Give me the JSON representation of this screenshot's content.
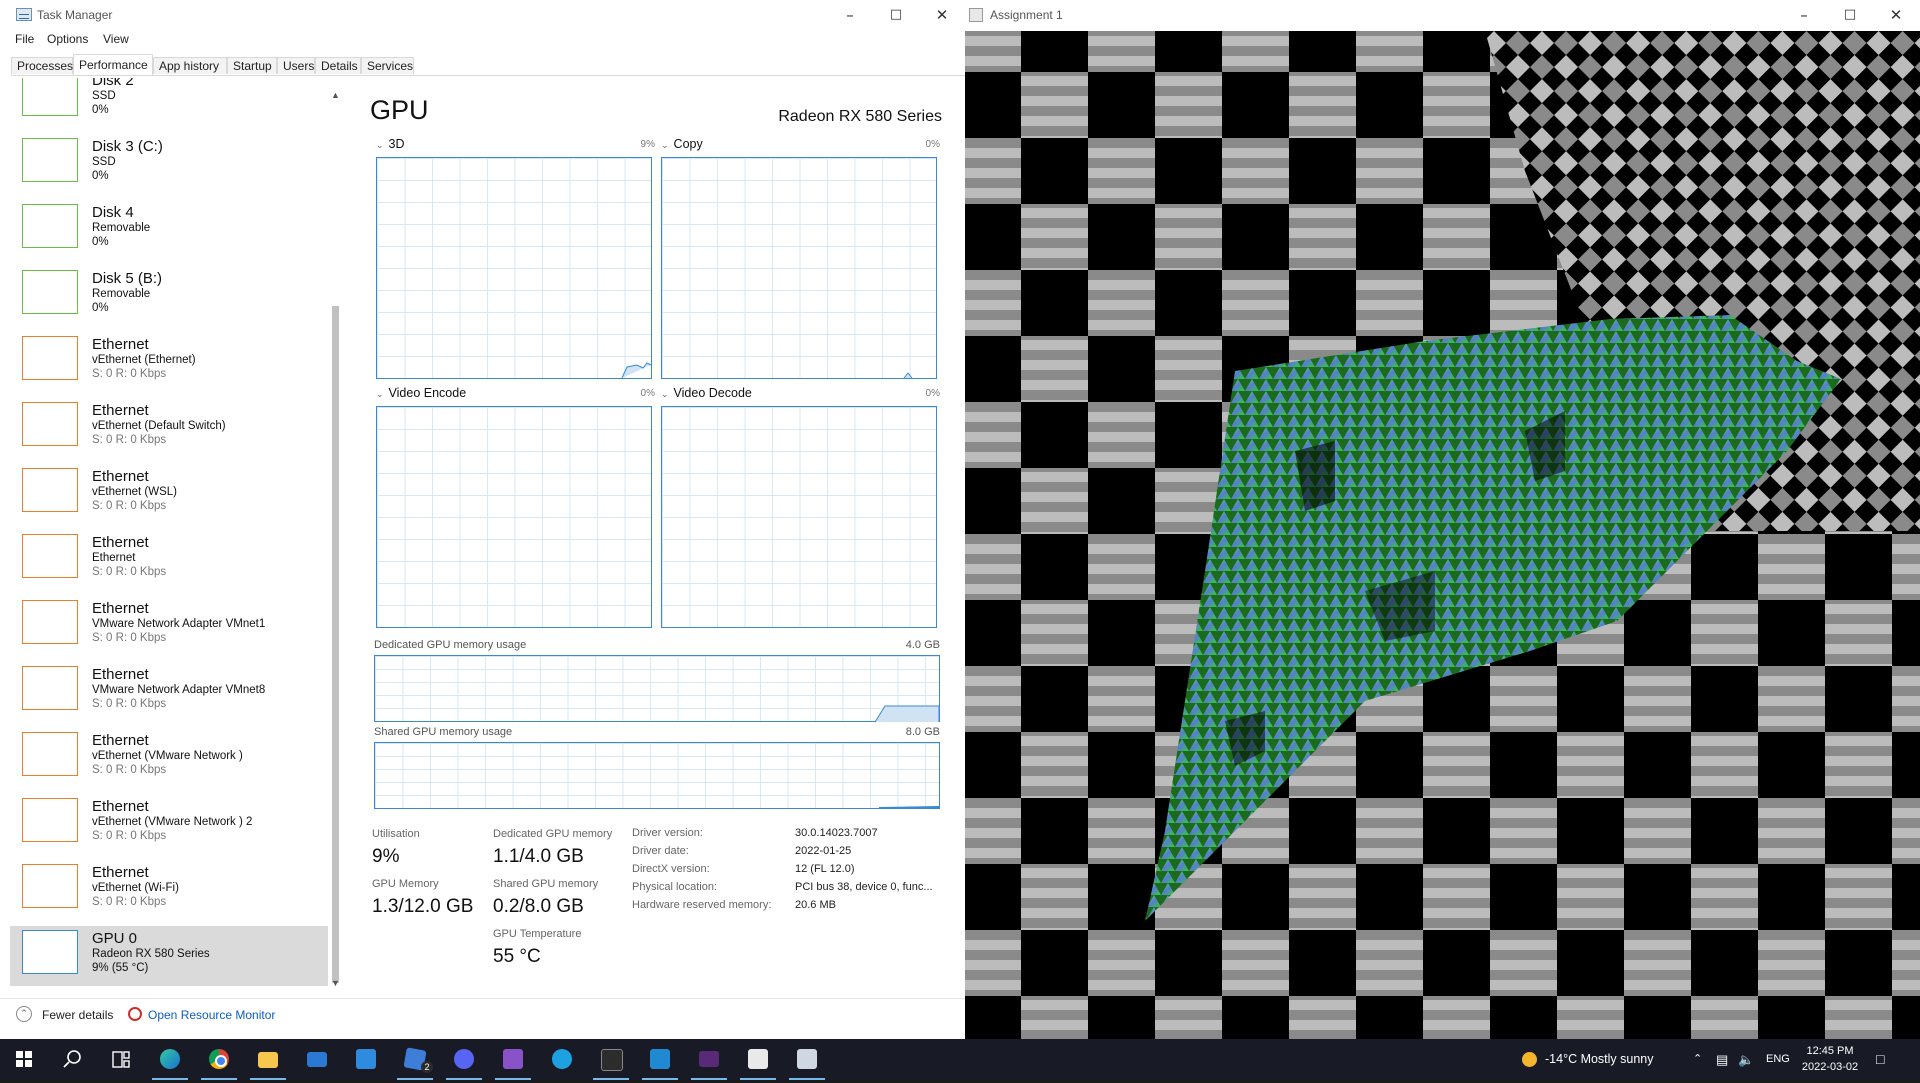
{
  "task_manager": {
    "title": "Task Manager",
    "menus": [
      "File",
      "Options",
      "View"
    ],
    "tabs": [
      "Processes",
      "Performance",
      "App history",
      "Startup",
      "Users",
      "Details",
      "Services"
    ],
    "active_tab": "Performance",
    "resources": [
      {
        "kind": "disk",
        "title": "Disk 2",
        "sub": "SSD",
        "val": "0%"
      },
      {
        "kind": "disk",
        "title": "Disk 3 (C:)",
        "sub": "SSD",
        "val": "0%"
      },
      {
        "kind": "disk",
        "title": "Disk 4",
        "sub": "Removable",
        "val": "0%"
      },
      {
        "kind": "disk",
        "title": "Disk 5 (B:)",
        "sub": "Removable",
        "val": "0%"
      },
      {
        "kind": "eth",
        "title": "Ethernet",
        "sub": "vEthernet (Ethernet)",
        "val": "S: 0 R: 0 Kbps"
      },
      {
        "kind": "eth",
        "title": "Ethernet",
        "sub": "vEthernet (Default Switch)",
        "val": "S: 0 R: 0 Kbps"
      },
      {
        "kind": "eth",
        "title": "Ethernet",
        "sub": "vEthernet (WSL)",
        "val": "S: 0 R: 0 Kbps"
      },
      {
        "kind": "eth",
        "title": "Ethernet",
        "sub": "Ethernet",
        "val": "S: 0 R: 0 Kbps"
      },
      {
        "kind": "eth",
        "title": "Ethernet",
        "sub": "VMware Network Adapter VMnet1",
        "val": "S: 0 R: 0 Kbps"
      },
      {
        "kind": "eth",
        "title": "Ethernet",
        "sub": "VMware Network Adapter VMnet8",
        "val": "S: 0 R: 0 Kbps"
      },
      {
        "kind": "eth",
        "title": "Ethernet",
        "sub": "vEthernet (VMware Network )",
        "val": "S: 0 R: 0 Kbps"
      },
      {
        "kind": "eth",
        "title": "Ethernet",
        "sub": "vEthernet (VMware Network ) 2",
        "val": "S: 0 R: 0 Kbps"
      },
      {
        "kind": "eth",
        "title": "Ethernet",
        "sub": "vEthernet (Wi-Fi)",
        "val": "S: 0 R: 0 Kbps"
      },
      {
        "kind": "gpu",
        "title": "GPU 0",
        "sub": "Radeon RX 580 Series",
        "val": "9% (55 °C)",
        "selected": true
      }
    ],
    "gpu": {
      "heading": "GPU",
      "model": "Radeon RX 580 Series",
      "engines": [
        {
          "name": "3D",
          "pct": "9%"
        },
        {
          "name": "Copy",
          "pct": "0%"
        },
        {
          "name": "Video Encode",
          "pct": "0%"
        },
        {
          "name": "Video Decode",
          "pct": "0%"
        }
      ],
      "dedicated_label": "Dedicated GPU memory usage",
      "dedicated_max": "4.0 GB",
      "shared_label": "Shared GPU memory usage",
      "shared_max": "8.0 GB",
      "stats": {
        "utilisation_label": "Utilisation",
        "utilisation": "9%",
        "dedicated_label": "Dedicated GPU memory",
        "dedicated": "1.1/4.0 GB",
        "gpu_memory_label": "GPU Memory",
        "gpu_memory": "1.3/12.0 GB",
        "shared_label": "Shared GPU memory",
        "shared": "0.2/8.0 GB",
        "temp_label": "GPU Temperature",
        "temp": "55 °C"
      },
      "driver": [
        {
          "label": "Driver version:",
          "value": "30.0.14023.7007"
        },
        {
          "label": "Driver date:",
          "value": "2022-01-25"
        },
        {
          "label": "DirectX version:",
          "value": "12 (FL 12.0)"
        },
        {
          "label": "Physical location:",
          "value": "PCI bus 38, device 0, func..."
        },
        {
          "label": "Hardware reserved memory:",
          "value": "20.6 MB"
        }
      ]
    },
    "footer": {
      "fewer": "Fewer details",
      "resource_monitor": "Open Resource Monitor"
    }
  },
  "assignment": {
    "title": "Assignment 1"
  },
  "taskbar": {
    "weather": "-14°C  Mostly sunny",
    "lang": "ENG",
    "time": "12:45 PM",
    "date": "2022-03-02",
    "icons": [
      "start-icon",
      "search-icon",
      "task-view-icon",
      "edge-icon",
      "chrome-icon",
      "file-explorer-icon",
      "mail-icon",
      "calendar-icon",
      "todo-icon",
      "discord-icon",
      "visual-studio-icon",
      "skype-icon",
      "terminal-icon",
      "vscode-icon",
      "app-purple-icon",
      "app-window-icon",
      "task-manager-icon"
    ],
    "badge": "2"
  }
}
